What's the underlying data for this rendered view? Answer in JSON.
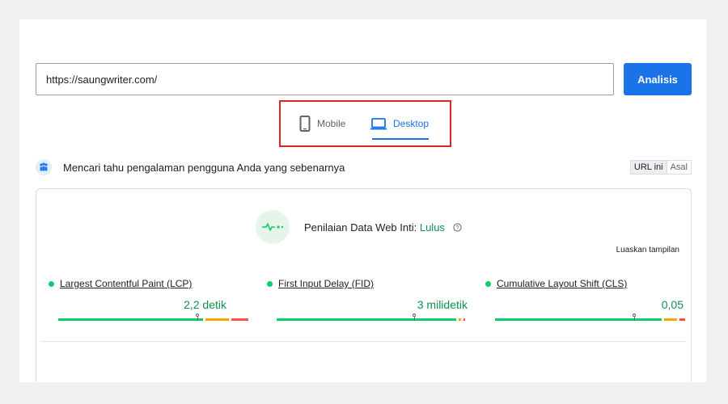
{
  "search": {
    "url_value": "https://saungwriter.com/"
  },
  "analyze_button": {
    "label": "Analisis"
  },
  "tabs": [
    {
      "label": "Mobile",
      "active": false
    },
    {
      "label": "Desktop",
      "active": true
    }
  ],
  "crux": {
    "heading": "Mencari tahu pengalaman pengguna Anda yang sebenarnya",
    "toggle": {
      "url_label": "URL ini",
      "origin_label": "Asal"
    }
  },
  "assessment": {
    "prefix": "Penilaian Data Web Inti: ",
    "status": "Lulus"
  },
  "expand_label": "Luaskan tampilan",
  "metrics": [
    {
      "name": "Largest Contentful Paint (LCP)",
      "value": "2,2 detik",
      "distribution": {
        "good": 0.78,
        "needs_improvement": 0.13,
        "poor": 0.09
      },
      "marker": 0.75
    },
    {
      "name": "First Input Delay (FID)",
      "value": "3 milidetik",
      "distribution": {
        "good": 0.98,
        "needs_improvement": 0.01,
        "poor": 0.01
      },
      "marker": 0.75
    },
    {
      "name": "Cumulative Layout Shift (CLS)",
      "value": "0,05",
      "distribution": {
        "good": 0.9,
        "needs_improvement": 0.07,
        "poor": 0.03
      },
      "marker": 0.75
    }
  ],
  "colors": {
    "accent": "#1a73e8",
    "good": "#0cce6b",
    "needs_improvement": "#ffa400",
    "poor": "#ff4e42",
    "highlight": "#d62828"
  }
}
